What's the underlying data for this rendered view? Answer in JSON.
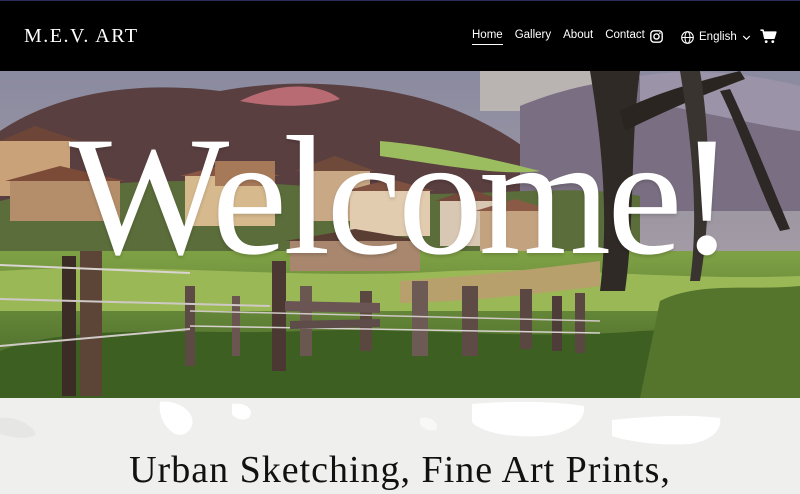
{
  "site": {
    "logo": "M.E.V. ART"
  },
  "nav": {
    "items": [
      {
        "label": "Home",
        "active": true
      },
      {
        "label": "Gallery",
        "active": false
      },
      {
        "label": "About",
        "active": false
      },
      {
        "label": "Contact",
        "active": false
      }
    ],
    "language": "English",
    "icons": [
      "instagram-icon",
      "globe-icon",
      "chevron-down-icon",
      "cart-icon"
    ]
  },
  "hero": {
    "title": "Welcome!"
  },
  "content": {
    "subheading": "Urban Sketching, Fine Art Prints,"
  },
  "colors": {
    "header_bg": "#000000",
    "header_text": "#ffffff",
    "band_bg": "#efefee",
    "subheading_text": "#111111"
  }
}
